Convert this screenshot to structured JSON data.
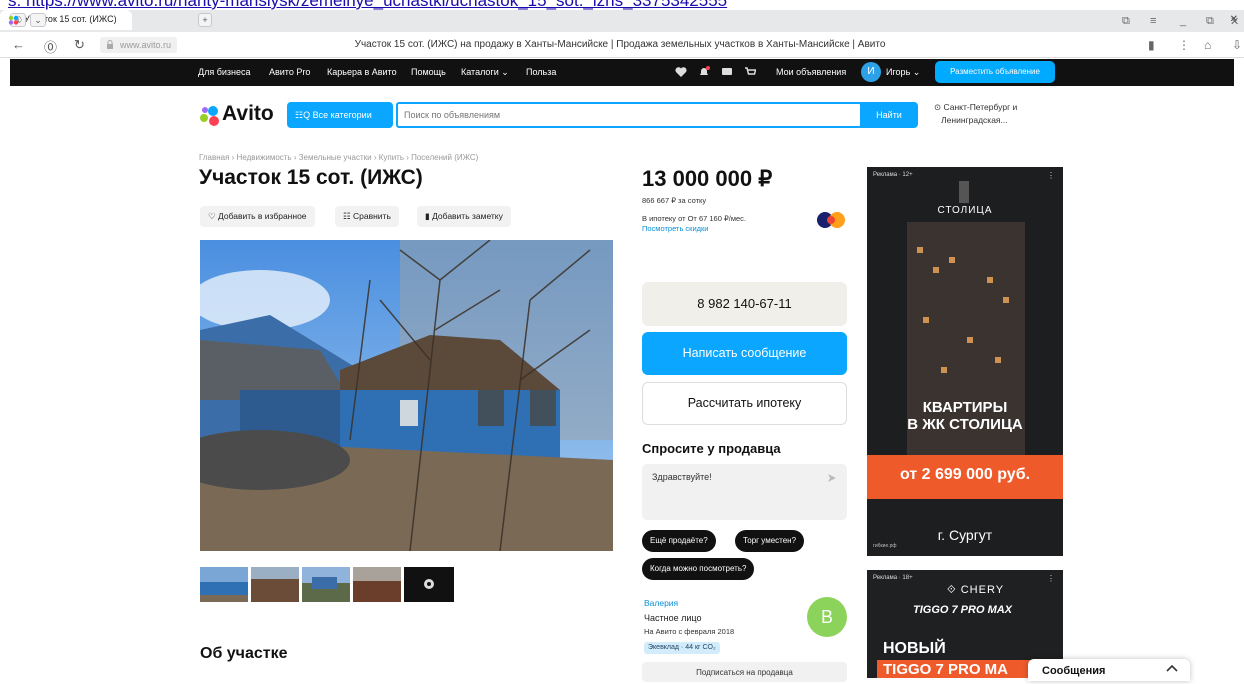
{
  "browser": {
    "url_text": "s: https://www.avito.ru/hanty-mansiysk/zemelnye_uchastki/uchastok_15_sot._izhs_3375342555",
    "tab_label": "Участок 15 сот. (ИЖС)",
    "domain": "www.avito.ru",
    "page_title": "Участок 15 сот. (ИЖС) на продажу в Ханты-Мансийске | Продажа земельных участков в Ханты-Мансийске | Авито"
  },
  "topnav": {
    "links": [
      "Для бизнеса",
      "Авито Pro",
      "Карьера в Авито",
      "Помощь",
      "Каталоги",
      "Польза"
    ],
    "my_ads": "Мои объявления",
    "user_initial": "И",
    "user_name": "Игорь",
    "post_ad": "Разместить объявление"
  },
  "header": {
    "logo_text": "Avito",
    "all_categories": "Все категории",
    "search_placeholder": "Поиск по объявлениям",
    "search_button": "Найти",
    "location_line1": "Санкт-Петербург и",
    "location_line2": "Ленинградская..."
  },
  "listing": {
    "breadcrumb": "Главная › Недвижимость › Земельные участки › Купить › Поселений (ИЖС)",
    "title": "Участок 15 сот. (ИЖС)",
    "actions": [
      "Добавить в избранное",
      "Сравнить",
      "Добавить заметку"
    ],
    "about_heading": "Об участке"
  },
  "price": {
    "value": "13 000 000 ₽",
    "per_sotka": "866 667 ₽ за сотку",
    "mortgage": "В ипотеку от От 67 160 ₽/мес.",
    "discounts": "Посмотреть скидки"
  },
  "contact": {
    "phone": "8 982 140-67-11",
    "write": "Написать сообщение",
    "mortgage_calc": "Рассчитать ипотеку",
    "ask_heading": "Спросите у продавца",
    "ask_message": "Здравствуйте!",
    "chips": [
      "Ещё продаёте?",
      "Торг уместен?",
      "Когда можно посмотреть?"
    ]
  },
  "seller": {
    "name": "Валерия",
    "type": "Частное лицо",
    "since": "На Авито с февраля 2018",
    "eco": "Экевклад · 44 кг CO₂",
    "initial": "В",
    "subscribe": "Подписаться на продавца"
  },
  "ads": {
    "ad1_tag": "Реклама · 12+",
    "ad1_brand": "СТОЛИЦА",
    "ad1_line1": "КВАРТИРЫ",
    "ad1_line2": "В ЖК СТОЛИЦА",
    "ad1_price": "от 2 699 000 руб.",
    "ad1_site": "гибкие.рф",
    "ad1_city": "г. Сургут",
    "ad2_tag": "Реклама · 18+",
    "ad2_brand": "CHERY",
    "ad2_model": "TIGGO 7 PRO MAX",
    "ad2_new": "НОВЫЙ",
    "ad2_title": "TIGGO 7 PRO MA"
  },
  "messages_label": "Сообщения",
  "colors": {
    "accent": "#0aa6ff",
    "nav_bg": "#111111",
    "ad_orange": "#ef5a2a",
    "seller_avatar": "#8bd35a"
  }
}
